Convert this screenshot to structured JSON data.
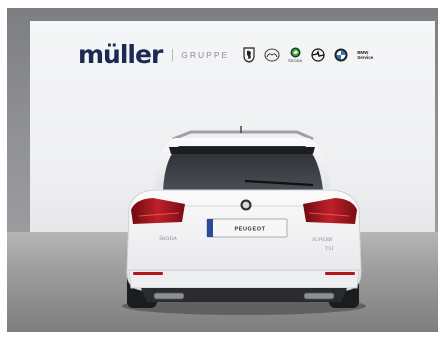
{
  "dealer": {
    "brand_name": "müller",
    "group_label": "GRUPPE",
    "partner_logos": [
      {
        "icon": "peugeot-lion-icon"
      },
      {
        "icon": "mazda-icon"
      },
      {
        "icon": "skoda-arrow-icon",
        "caption": "ŠKODA"
      },
      {
        "icon": "opel-blitz-icon"
      },
      {
        "icon": "bmw-roundel-icon"
      },
      {
        "icon": "bmw-service-icon",
        "caption": "BMW Service"
      }
    ]
  },
  "vehicle": {
    "plate_text": "PEUGEOT",
    "badge_left": "ŠKODA",
    "badge_right": "SUPERB",
    "badge_right_sub": "TSI"
  },
  "colors": {
    "brand_navy": "#1a2a53",
    "car_body": "#f4f5f6",
    "taillight": "#a3121c",
    "backdrop": "#eeeff1",
    "floor": "#9c9c9c"
  }
}
